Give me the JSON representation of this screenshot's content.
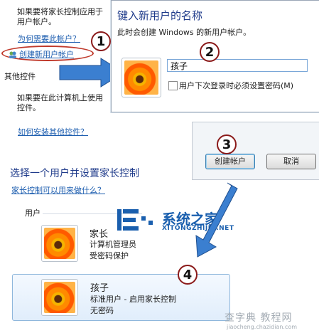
{
  "left_panel": {
    "line1": "如果要将家长控制应用于",
    "line2": "用户帐户。",
    "why_link": "为何需要此帐户？",
    "create_link": "创建新用户帐户",
    "other_controls": "其他控件",
    "other_desc1": "如果要在此计算机上使用",
    "other_desc2": "控件。",
    "install_link": "如何安装其他控件？"
  },
  "dialog": {
    "title": "键入新用户的名称",
    "subtitle": "此时会创建 Windows 的新用户帐户。",
    "name_value": "孩子",
    "pw_checkbox_label": "用户下次登录时必须设置密码(M)"
  },
  "buttons": {
    "create": "创建帐户",
    "cancel": "取消"
  },
  "badges": [
    "1",
    "2",
    "3",
    "4"
  ],
  "section": {
    "heading": "选择一个用户并设置家长控制",
    "what_link": "家长控制可以用来做什么？",
    "users_label": "用户"
  },
  "users": [
    {
      "name": "家长",
      "line1": "计算机管理员",
      "line2": "受密码保护"
    },
    {
      "name": "孩子",
      "line1": "标准用户 - 启用家长控制",
      "line2": "无密码"
    }
  ],
  "watermark": {
    "logo": "系统之家",
    "logo_sub": "XITONGZHIJIA.NET",
    "site": "查字典 教程网",
    "url": "jiaocheng.chazidian.com"
  },
  "colors": {
    "accent_link": "#1f5fb0",
    "badge_border": "#8b1a1a",
    "arrow": "#3b7fd0"
  }
}
